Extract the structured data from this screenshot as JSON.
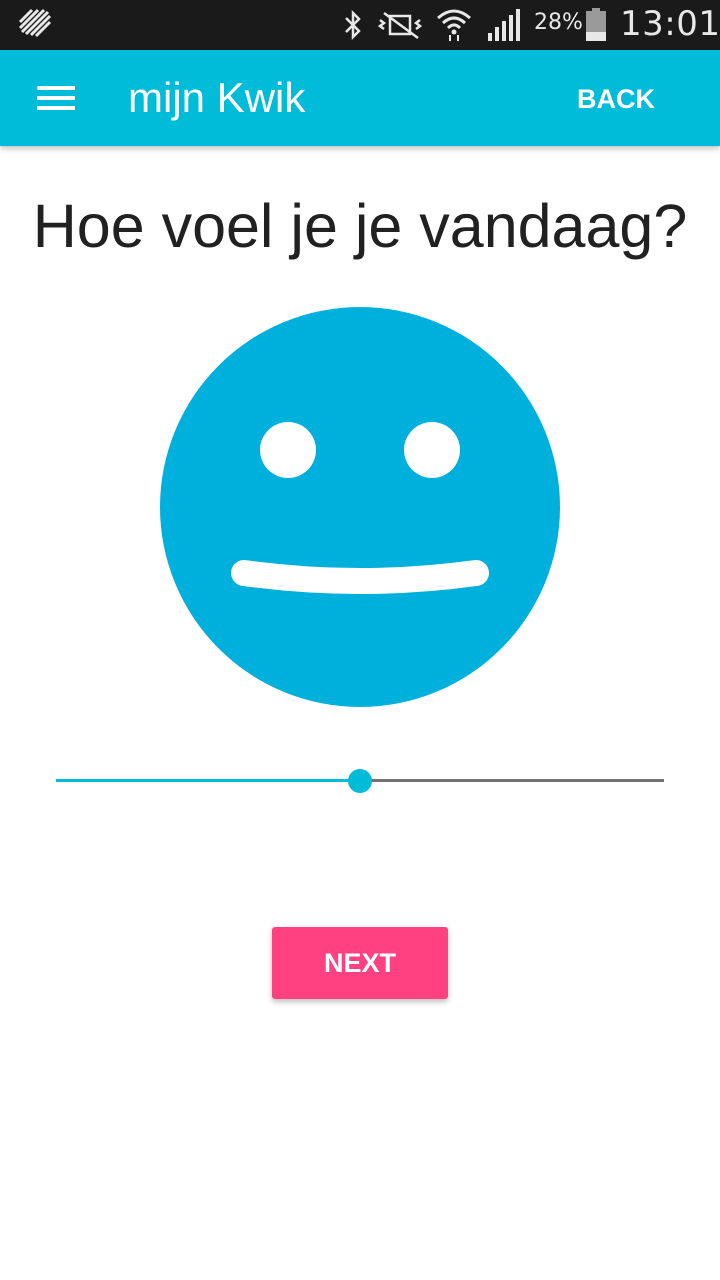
{
  "status_bar": {
    "battery_percent": "28%",
    "time": "13:01",
    "icons": [
      "notification-icon",
      "bluetooth-icon",
      "mute-vibrate-icon",
      "wifi-icon",
      "signal-icon",
      "battery-icon"
    ]
  },
  "app_bar": {
    "title": "mijn Kwik",
    "back_label": "BACK",
    "menu_icon": "hamburger-menu-icon"
  },
  "main": {
    "question": "Hoe voel je je vandaag?",
    "mood_icon": "smiley-face-icon",
    "slider_value": 0.5,
    "next_label": "NEXT"
  },
  "colors": {
    "accent": "#00bcd8",
    "face": "#00b0dc",
    "button": "#ff4081",
    "status_bar": "#1a1a1a",
    "slider_track": "#727272"
  }
}
